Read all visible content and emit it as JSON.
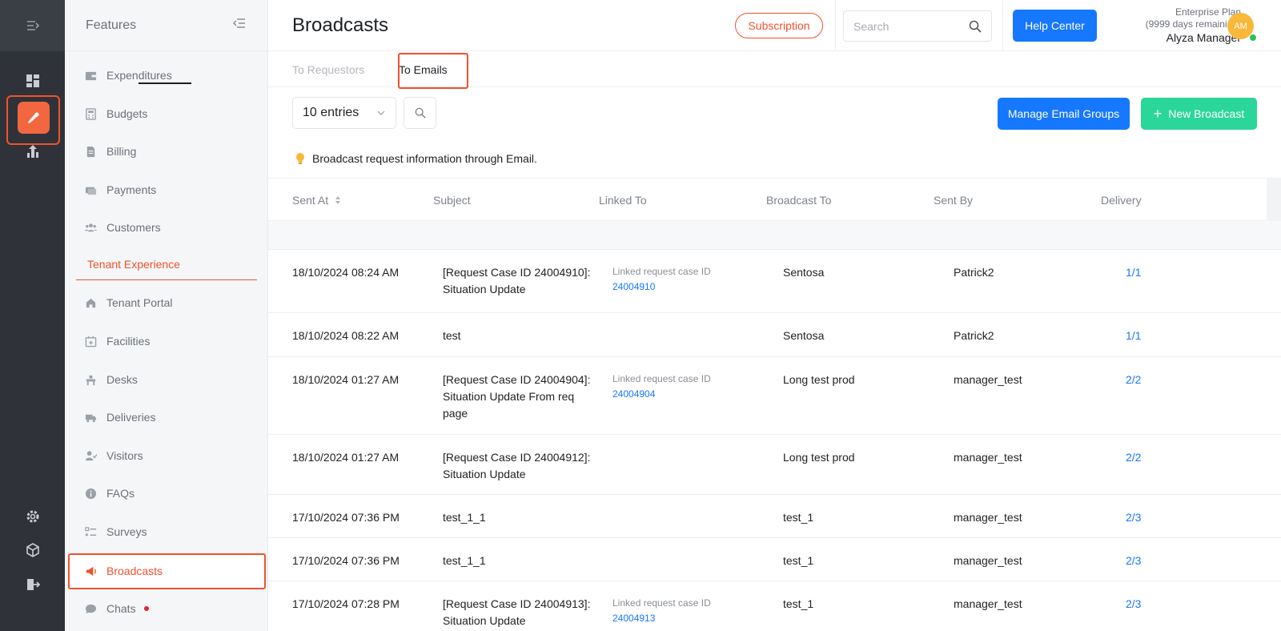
{
  "rail": {
    "icons": [
      "menu-expand-icon",
      "dashboard-icon",
      "broadcast-icon",
      "analytics-icon",
      "settings-icon",
      "cube-icon",
      "logout-icon"
    ]
  },
  "features": {
    "title": "Features",
    "items": [
      {
        "label": "Expenditures",
        "icon": "wallet-icon"
      },
      {
        "label": "Budgets",
        "icon": "calculator-icon"
      },
      {
        "label": "Billing",
        "icon": "document-icon"
      },
      {
        "label": "Payments",
        "icon": "card-icon"
      },
      {
        "label": "Customers",
        "icon": "people-icon"
      }
    ],
    "section": "Tenant Experience",
    "tenant_items": [
      {
        "label": "Tenant Portal",
        "icon": "home-icon"
      },
      {
        "label": "Facilities",
        "icon": "calendar-plus-icon"
      },
      {
        "label": "Desks",
        "icon": "desk-icon"
      },
      {
        "label": "Deliveries",
        "icon": "truck-icon"
      },
      {
        "label": "Visitors",
        "icon": "visitor-icon"
      },
      {
        "label": "FAQs",
        "icon": "info-icon"
      },
      {
        "label": "Surveys",
        "icon": "checklist-icon"
      },
      {
        "label": "Broadcasts",
        "icon": "megaphone-icon"
      },
      {
        "label": "Chats",
        "icon": "chat-icon"
      }
    ]
  },
  "header": {
    "title": "Broadcasts",
    "subscription_label": "Subscription",
    "search_placeholder": "Search",
    "help_label": "Help Center",
    "plan_name": "Enterprise Plan",
    "plan_remaining": "(9999 days remaining)",
    "user_name": "Alyza Manager",
    "avatar_initials": "AM"
  },
  "tabs": [
    {
      "label": "To Requestors",
      "active": false
    },
    {
      "label": "To Emails",
      "active": true
    }
  ],
  "toolbar": {
    "entries_label": "10 entries",
    "manage_label": "Manage Email Groups",
    "new_label": "New Broadcast"
  },
  "info_text": "Broadcast request information through Email.",
  "table": {
    "columns": [
      "Sent At",
      "Subject",
      "Linked To",
      "Broadcast To",
      "Sent By",
      "Delivery"
    ],
    "rows": [
      {
        "sent_at": "18/10/2024 08:24 AM",
        "subject": [
          "[Request Case ID 24004910]:",
          "Situation Update"
        ],
        "linked_label": "Linked request case ID",
        "linked_id": "24004910",
        "broadcast_to": "Sentosa",
        "sent_by": "Patrick2",
        "delivery": "1/1"
      },
      {
        "sent_at": "18/10/2024 08:22 AM",
        "subject": [
          "test"
        ],
        "linked_label": "",
        "linked_id": "",
        "broadcast_to": "Sentosa",
        "sent_by": "Patrick2",
        "delivery": "1/1"
      },
      {
        "sent_at": "18/10/2024 01:27 AM",
        "subject": [
          "[Request Case ID 24004904]:",
          "Situation Update From req",
          "page"
        ],
        "linked_label": "Linked request case ID",
        "linked_id": "24004904",
        "broadcast_to": "Long test prod",
        "sent_by": "manager_test",
        "delivery": "2/2"
      },
      {
        "sent_at": "18/10/2024 01:27 AM",
        "subject": [
          "[Request Case ID 24004912]:",
          "Situation Update"
        ],
        "linked_label": "",
        "linked_id": "",
        "broadcast_to": "Long test prod",
        "sent_by": "manager_test",
        "delivery": "2/2"
      },
      {
        "sent_at": "17/10/2024 07:36 PM",
        "subject": [
          "test_1_1"
        ],
        "linked_label": "",
        "linked_id": "",
        "broadcast_to": "test_1",
        "sent_by": "manager_test",
        "delivery": "2/3"
      },
      {
        "sent_at": "17/10/2024 07:36 PM",
        "subject": [
          "test_1_1"
        ],
        "linked_label": "",
        "linked_id": "",
        "broadcast_to": "test_1",
        "sent_by": "manager_test",
        "delivery": "2/3"
      },
      {
        "sent_at": "17/10/2024 07:28 PM",
        "subject": [
          "[Request Case ID 24004913]:",
          "Situation Update"
        ],
        "linked_label": "Linked request case ID",
        "linked_id": "24004913",
        "broadcast_to": "test_1",
        "sent_by": "manager_test",
        "delivery": "2/3"
      }
    ]
  },
  "colors": {
    "accent": "#f0522d",
    "primary": "#1677ff",
    "success": "#2bd69a",
    "rail_bg": "#2f3339"
  }
}
